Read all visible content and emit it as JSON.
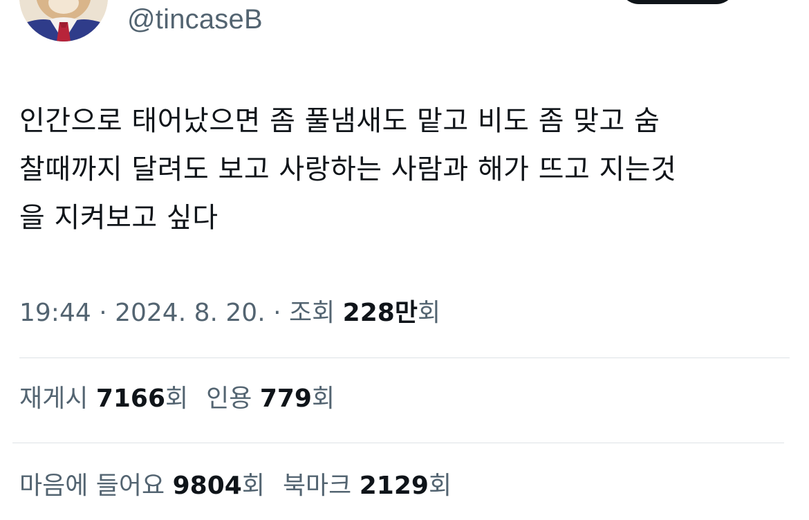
{
  "author": {
    "handle": "@tincaseB",
    "avatar_icon": "profile-avatar-dog-in-suit"
  },
  "tweet": {
    "lines": [
      "인간으로 태어났으면 좀 풀냄새도 맡고 비도 좀 맞고 숨",
      "찰때까지 달려도 보고 사랑하는 사람과 해가 뜨고 지는것",
      "을 지켜보고 싶다"
    ]
  },
  "meta": {
    "time": "19:44",
    "separator_1": " · ",
    "date": "2024. 8. 20.",
    "separator_2": " · ",
    "views_label": "조회 ",
    "views_count": "228만",
    "views_unit": "회"
  },
  "stats": {
    "reposts_label": "재게시 ",
    "reposts_count": "7166",
    "reposts_unit": "회",
    "quotes_label": "인용 ",
    "quotes_count": "779",
    "quotes_unit": "회",
    "likes_label": "마음에 들어요 ",
    "likes_count": "9804",
    "likes_unit": "회",
    "bookmarks_label": "북마크 ",
    "bookmarks_count": "2129",
    "bookmarks_unit": "회"
  },
  "colors": {
    "text_primary": "#0f1419",
    "text_secondary": "#536471",
    "divider": "#dde2e6",
    "follow_button": "#0f1419"
  }
}
